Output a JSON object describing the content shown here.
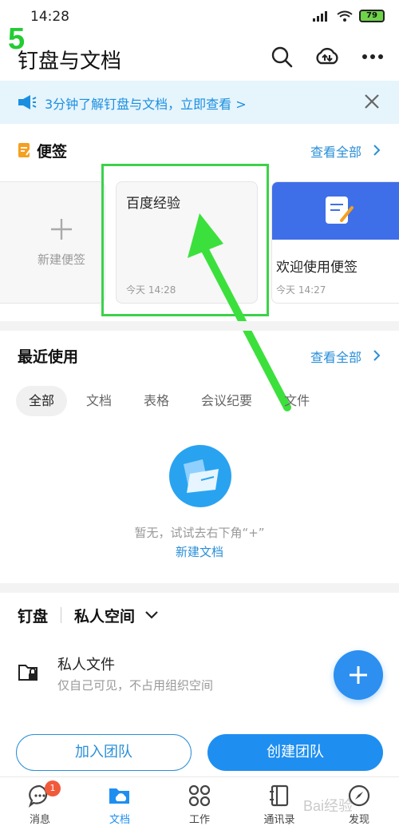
{
  "status_bar": {
    "time": "14:28",
    "battery": "79"
  },
  "overlay": {
    "step_number": "5"
  },
  "header": {
    "title": "钉盘与文档"
  },
  "banner": {
    "text": "3分钟了解钉盘与文档，立即查看 >"
  },
  "notes": {
    "title": "便签",
    "view_all": "查看全部",
    "new_label": "新建便签",
    "cards": [
      {
        "title": "百度经验",
        "time": "今天 14:28"
      },
      {
        "title": "欢迎使用便签",
        "time": "今天 14:27"
      }
    ]
  },
  "recent": {
    "title": "最近使用",
    "view_all": "查看全部",
    "tabs": [
      "全部",
      "文档",
      "表格",
      "会议纪要",
      "文件"
    ],
    "empty_text": "暂无，试试去右下角“+”",
    "empty_link": "新建文档"
  },
  "drive": {
    "label": "钉盘",
    "space": "私人空间",
    "private_title": "私人文件",
    "private_desc": "仅自己可见，不占用组织空间"
  },
  "actions": {
    "join": "加入团队",
    "create": "创建团队"
  },
  "tabbar": {
    "items": [
      {
        "label": "消息",
        "badge": "1"
      },
      {
        "label": "文档"
      },
      {
        "label": "工作"
      },
      {
        "label": "通讯录"
      },
      {
        "label": "发现"
      }
    ]
  },
  "watermark": "Bai经验",
  "colors": {
    "accent": "#1e8ff0",
    "banner_bg": "#e6f4fc",
    "highlight": "#3cd24a",
    "badge": "#f05a3a"
  }
}
